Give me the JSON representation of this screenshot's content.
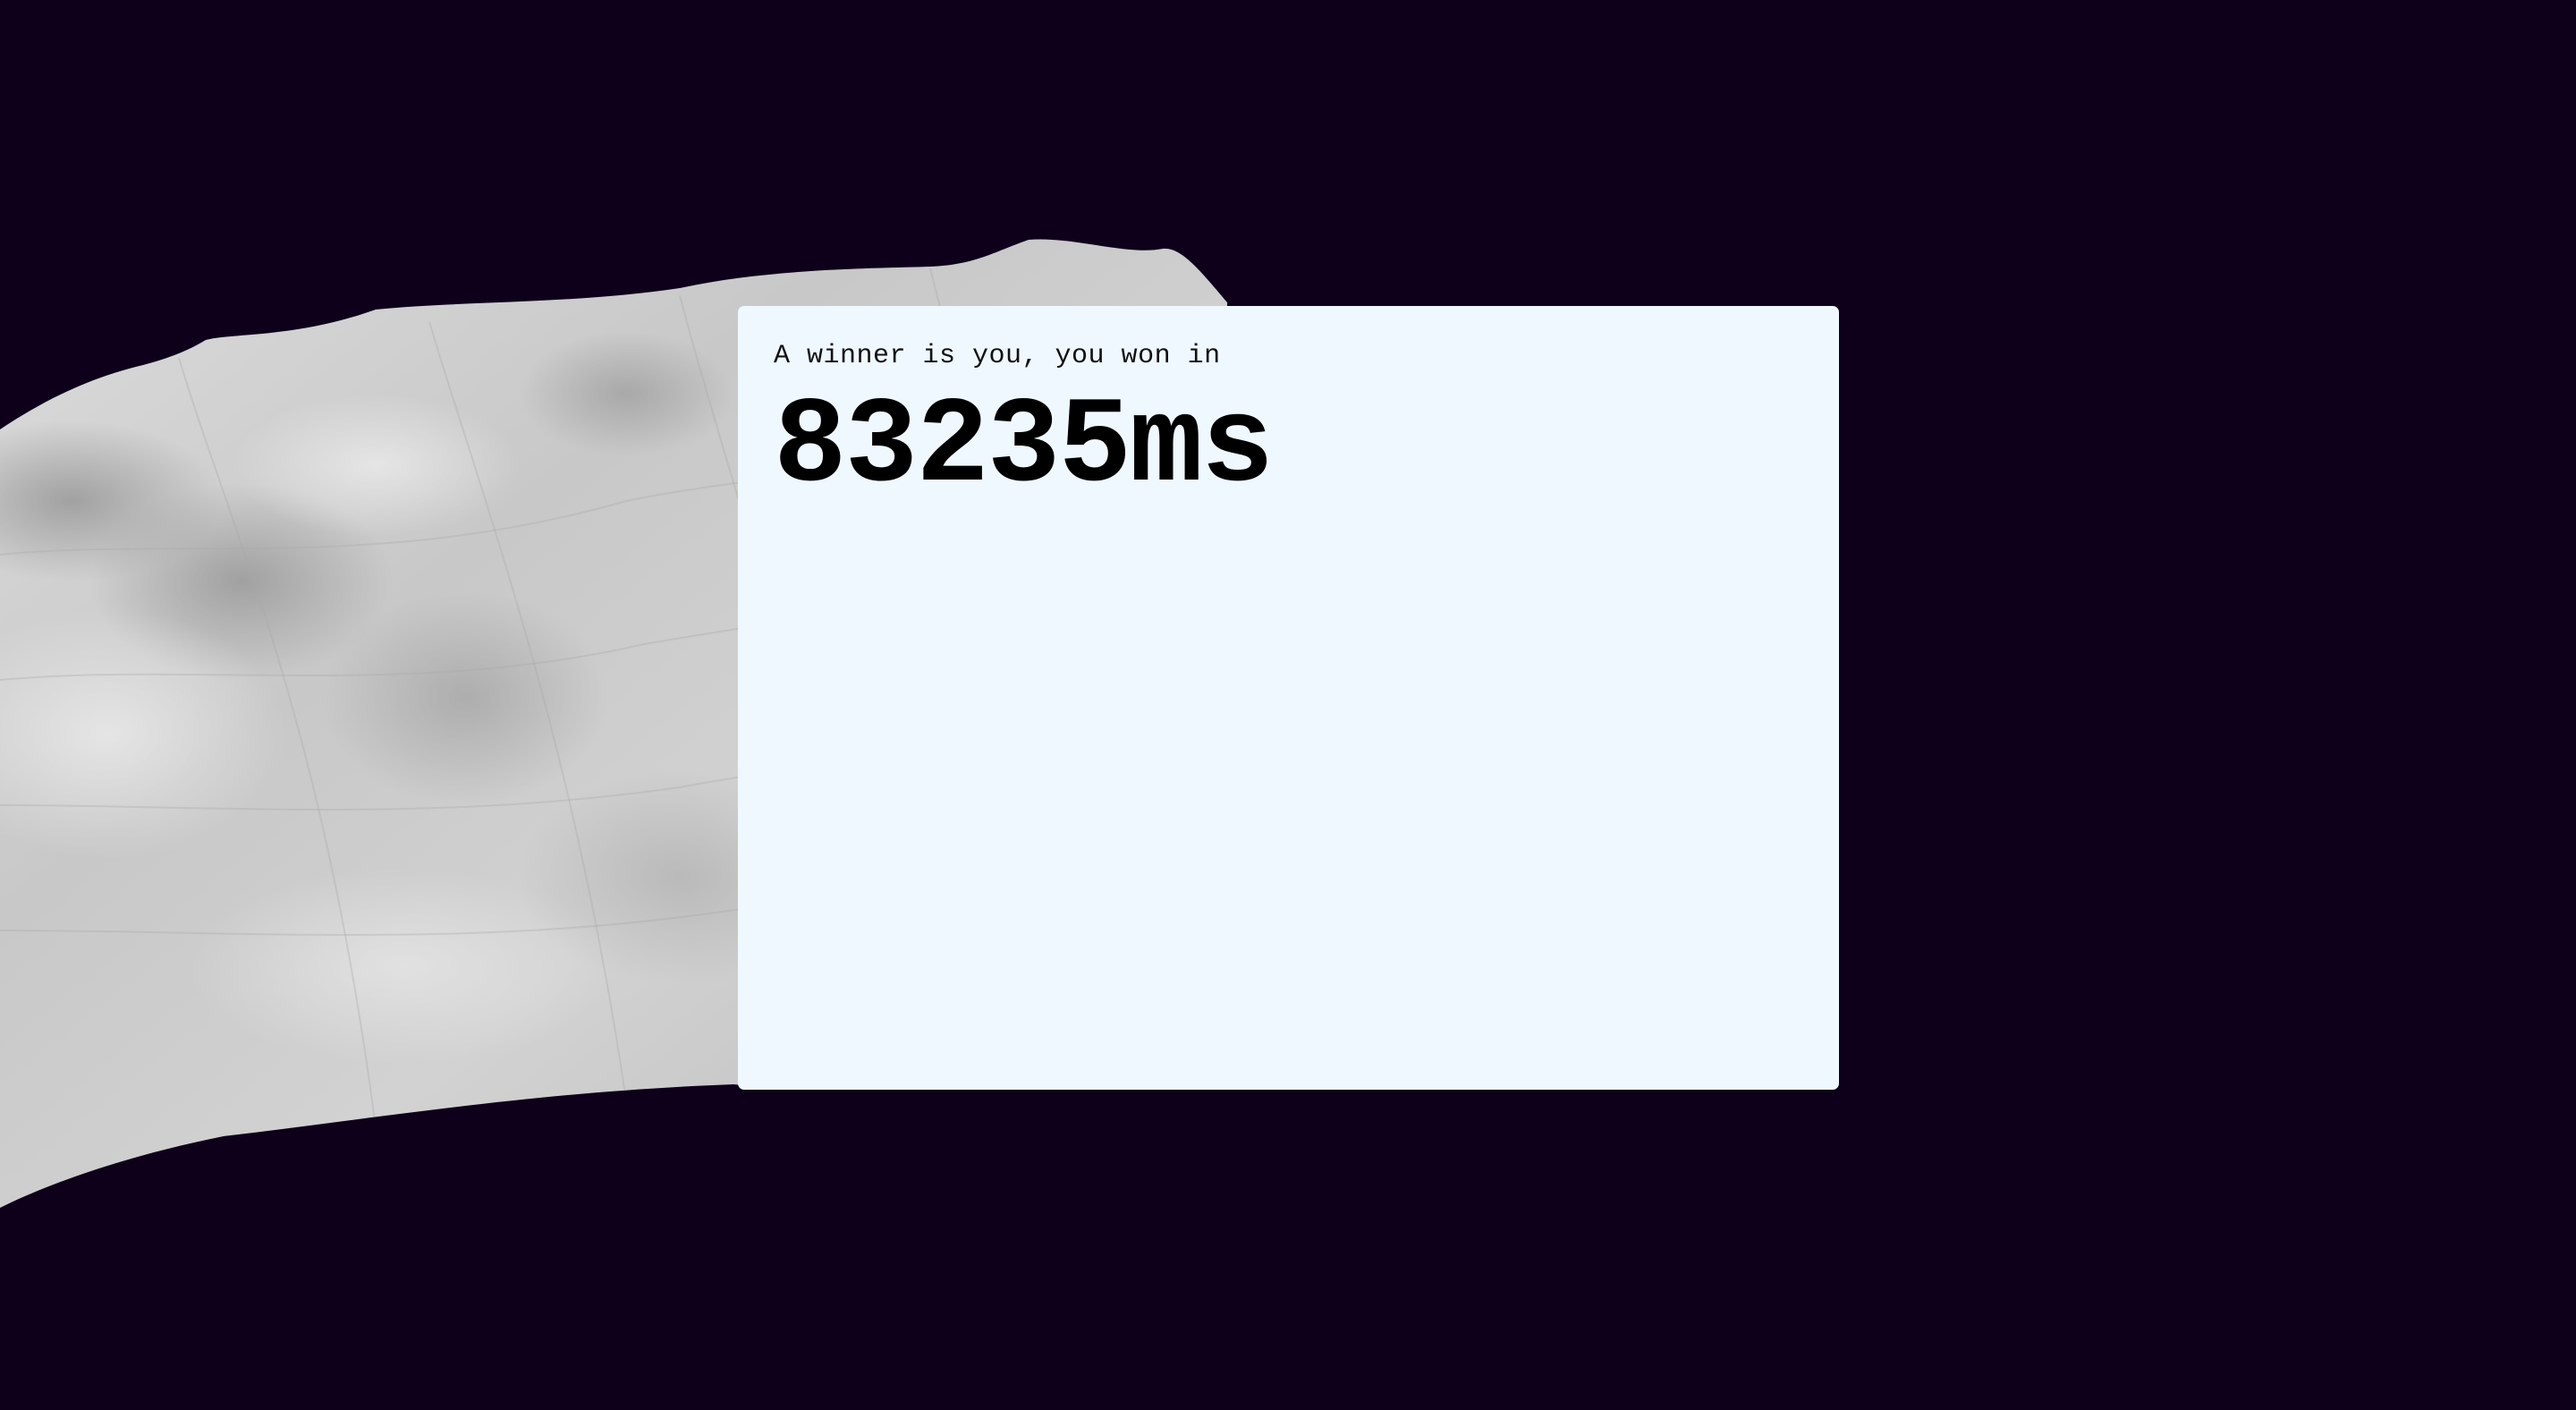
{
  "theme": {
    "background": "#0e001a",
    "panel_background": "#f0f8ff",
    "terrain_light": "#d9d9d9",
    "terrain_mid": "#bdbdbd",
    "terrain_dark": "#9e9e9e"
  },
  "result": {
    "caption": "A winner is you, you won in",
    "time": "83235ms"
  }
}
